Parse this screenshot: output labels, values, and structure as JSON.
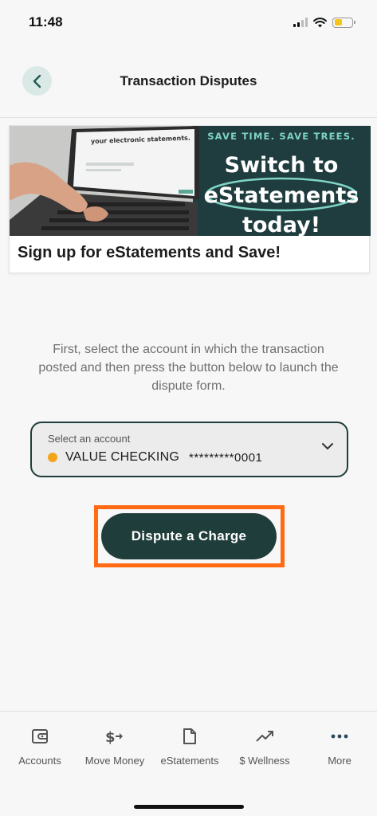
{
  "status_bar": {
    "time": "11:48"
  },
  "header": {
    "title": "Transaction Disputes",
    "back_icon": "chevron-left-icon"
  },
  "banner": {
    "tagline": "SAVE TIME. SAVE TREES.",
    "headline_1": "Switch to",
    "headline_2": "eStatements",
    "headline_3": "today!",
    "screen_text": "your electronic statements.",
    "caption": "Sign up for eStatements and Save!"
  },
  "instructions": "First, select the account in which the transaction posted and then press the button below to launch the dispute form.",
  "account_select": {
    "label": "Select an account",
    "account_name": "VALUE CHECKING",
    "account_number": "*********0001",
    "status_color": "#f3a51a"
  },
  "dispute_button": {
    "label": "Dispute a Charge"
  },
  "bottom_nav": {
    "items": [
      {
        "label": "Accounts",
        "icon": "wallet-icon"
      },
      {
        "label": "Move Money",
        "icon": "dollar-transfer-icon"
      },
      {
        "label": "eStatements",
        "icon": "document-icon"
      },
      {
        "label": "$ Wellness",
        "icon": "trending-up-icon"
      },
      {
        "label": "More",
        "icon": "more-dots-icon"
      }
    ]
  },
  "colors": {
    "primary": "#1f3d3b",
    "accent_highlight": "#ff6a13",
    "banner_teal": "#1f3c3f",
    "banner_aqua": "#7fd3c2"
  }
}
